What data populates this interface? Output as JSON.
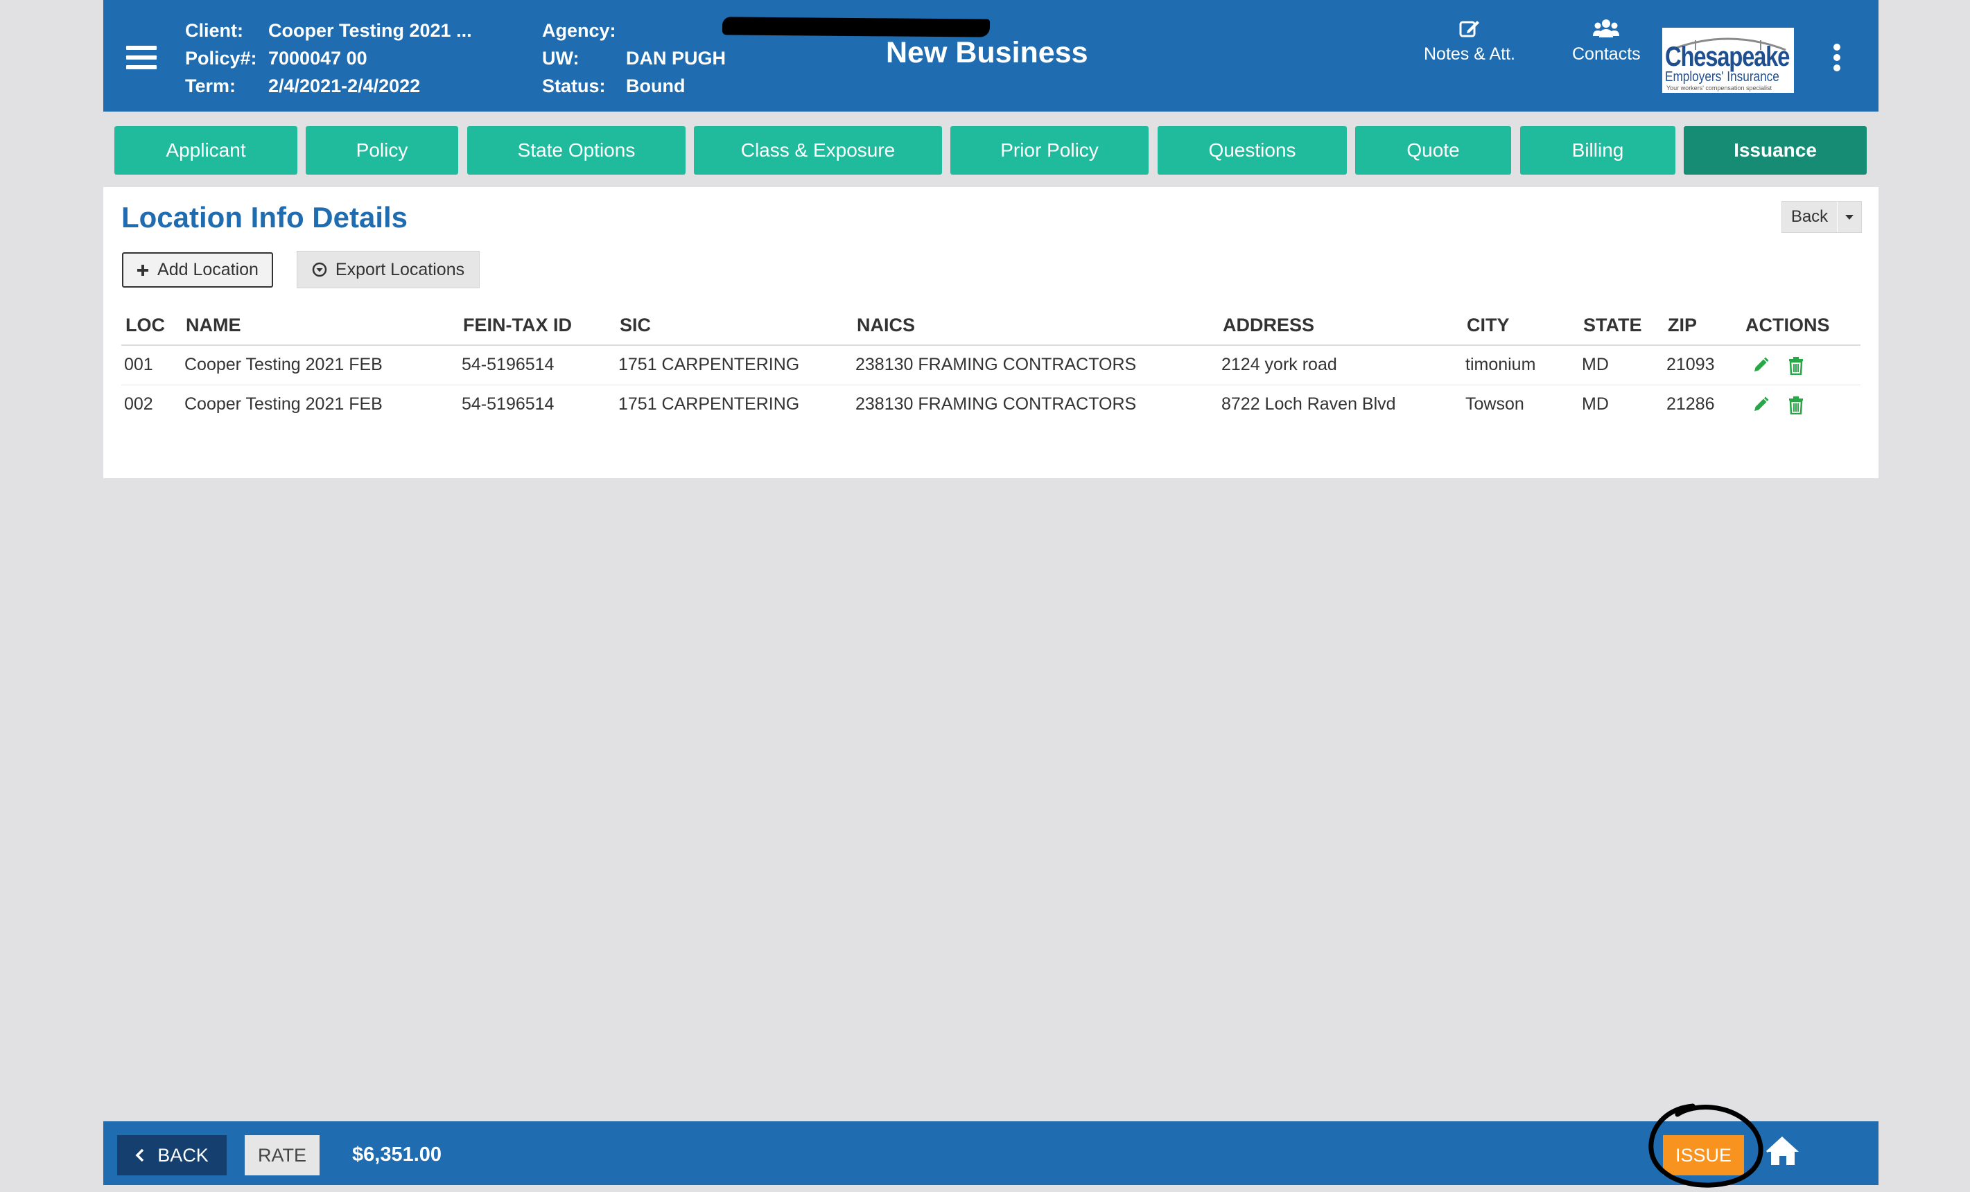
{
  "header": {
    "client_label": "Client:",
    "client_value": "Cooper Testing 2021 ...",
    "policy_label": "Policy#:",
    "policy_value": "7000047 00",
    "term_label": "Term:",
    "term_value": "2/4/2021-2/4/2022",
    "agency_label": "Agency:",
    "uw_label": "UW:",
    "uw_value": "DAN PUGH",
    "status_label": "Status:",
    "status_value": "Bound",
    "title": "New Business",
    "notes_label": "Notes & Att.",
    "contacts_label": "Contacts",
    "logo": {
      "name": "Chesapeake",
      "line2": "Employers' Insurance",
      "tagline": "Your workers' compensation specialist"
    }
  },
  "tabs": [
    {
      "label": "Applicant"
    },
    {
      "label": "Policy"
    },
    {
      "label": "State Options"
    },
    {
      "label": "Class & Exposure"
    },
    {
      "label": "Prior Policy"
    },
    {
      "label": "Questions"
    },
    {
      "label": "Quote"
    },
    {
      "label": "Billing"
    },
    {
      "label": "Issuance",
      "active": true
    }
  ],
  "main": {
    "title": "Location Info Details",
    "back_label": "Back",
    "add_location_label": "Add Location",
    "export_locations_label": "Export Locations",
    "columns": [
      "LOC",
      "NAME",
      "FEIN-TAX ID",
      "SIC",
      "NAICS",
      "ADDRESS",
      "CITY",
      "STATE",
      "ZIP",
      "ACTIONS"
    ],
    "rows": [
      {
        "loc": "001",
        "name": "Cooper Testing 2021 FEB",
        "fein": "54-5196514",
        "sic": "1751 CARPENTERING",
        "naics": "238130 FRAMING CONTRACTORS",
        "address": "2124 york road",
        "city": "timonium",
        "state": "MD",
        "zip": "21093"
      },
      {
        "loc": "002",
        "name": "Cooper Testing 2021 FEB",
        "fein": "54-5196514",
        "sic": "1751 CARPENTERING",
        "naics": "238130 FRAMING CONTRACTORS",
        "address": "8722 Loch Raven Blvd",
        "city": "Towson",
        "state": "MD",
        "zip": "21286"
      }
    ]
  },
  "footer": {
    "back_label": "BACK",
    "rate_label": "RATE",
    "premium": "$6,351.00",
    "issue_label": "ISSUE"
  },
  "colors": {
    "brand_blue": "#1f6cb0",
    "tab_green": "#1fbb9c",
    "tab_active": "#168c75",
    "issue_orange": "#f7931e",
    "action_green": "#27a745"
  },
  "icons": [
    "menu-icon",
    "edit-note-icon",
    "contacts-icon",
    "kebab-menu-icon",
    "plus-icon",
    "download-circle-icon",
    "pencil-icon",
    "trash-icon",
    "chevron-left-icon",
    "home-icon",
    "caret-down-icon"
  ]
}
